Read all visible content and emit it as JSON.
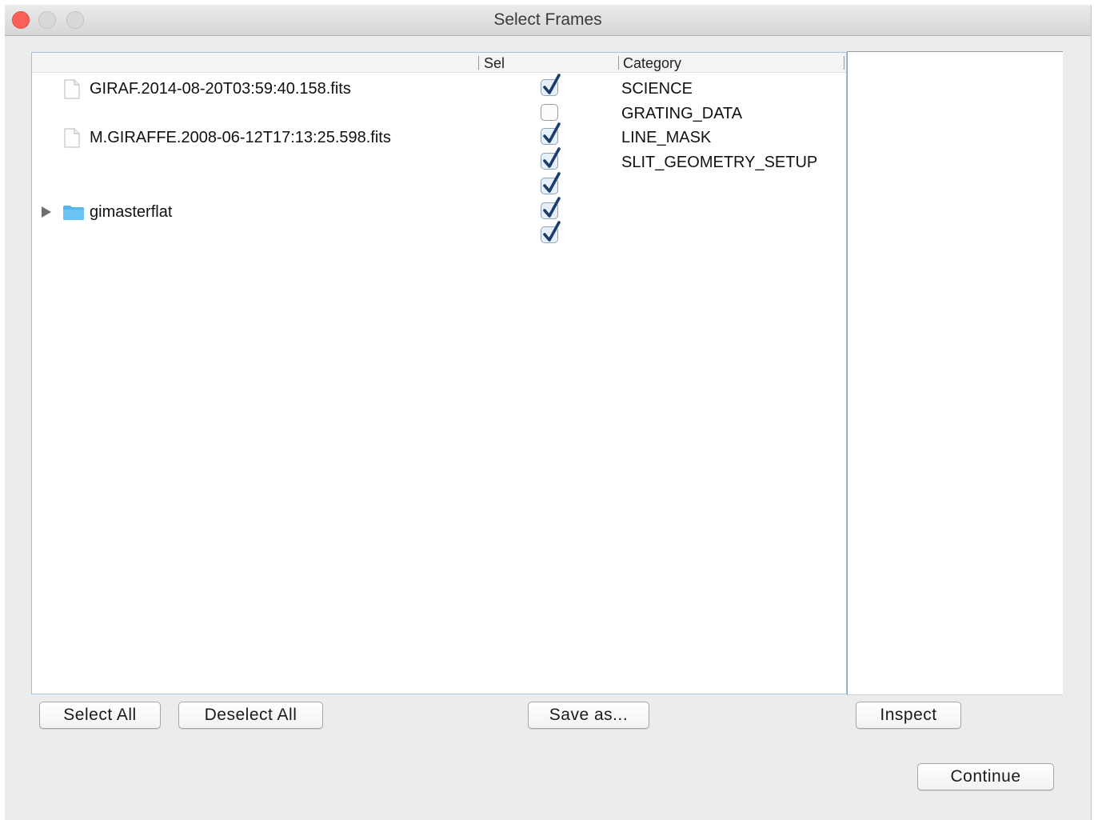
{
  "window": {
    "title": "Select Frames"
  },
  "table": {
    "columns": {
      "file": "",
      "sel": "Sel",
      "category": "Category"
    },
    "rows": [
      {
        "type": "file",
        "name": "GIRAF.2014-08-20T03:59:40.158.fits",
        "checked": true,
        "category": "SCIENCE"
      },
      {
        "type": "blank",
        "name": "",
        "checked": false,
        "category": "GRATING_DATA"
      },
      {
        "type": "file",
        "name": "M.GIRAFFE.2008-06-12T17:13:25.598.fits",
        "checked": true,
        "category": "LINE_MASK"
      },
      {
        "type": "blank",
        "name": "",
        "checked": true,
        "category": "SLIT_GEOMETRY_SETUP"
      },
      {
        "type": "blank",
        "name": "",
        "checked": true,
        "category": ""
      },
      {
        "type": "folder",
        "name": "gimasterflat",
        "checked": true,
        "category": "",
        "expandable": true
      },
      {
        "type": "blank",
        "name": "",
        "checked": true,
        "category": ""
      }
    ]
  },
  "buttons": {
    "select_all": "Select All",
    "deselect_all": "Deselect All",
    "save_as": "Save as...",
    "inspect": "Inspect",
    "continue": "Continue"
  },
  "colors": {
    "accent": "#1a3c6e",
    "selection_border": "#9ec3e6",
    "folder": "#5ab8ee",
    "close": "#fc5f57"
  },
  "icons": {
    "file": "document-icon",
    "folder": "folder-icon",
    "expander": "disclosure-triangle-icon",
    "check": "checkmark-icon"
  }
}
